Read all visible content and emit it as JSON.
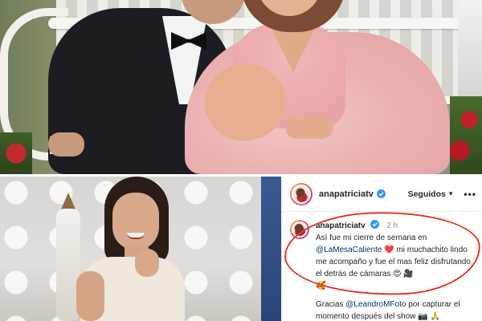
{
  "post": {
    "username": "anapatriciatv",
    "follow_label": "Seguidos",
    "more_label": "•••",
    "caption_user": "anapatriciatv",
    "time": "2 h",
    "caption_1a": "Así fue mi cierre de semana en",
    "mention_1": "@LaMesaCaliente",
    "heart": "❤️",
    "caption_1b": "mi muchachito lindo me acompaño y fue el mas feliz disfrutando el detrás de cámaras",
    "caption_emojis": "😍 🎥",
    "caption_emoji_2": "🥰",
    "caption_2a": "Gracias",
    "mention_2": "@LeandroMFoto",
    "caption_2b": "por capturar el momento después del show",
    "caption_2_emojis": "📷 🙏"
  },
  "colors": {
    "mention": "#00376b",
    "annotation": "#e0382b",
    "verified": "#3897f0"
  },
  "icons": {
    "verified": "verified-badge-icon",
    "chevron": "chevron-down-icon",
    "more": "more-dots-icon"
  }
}
